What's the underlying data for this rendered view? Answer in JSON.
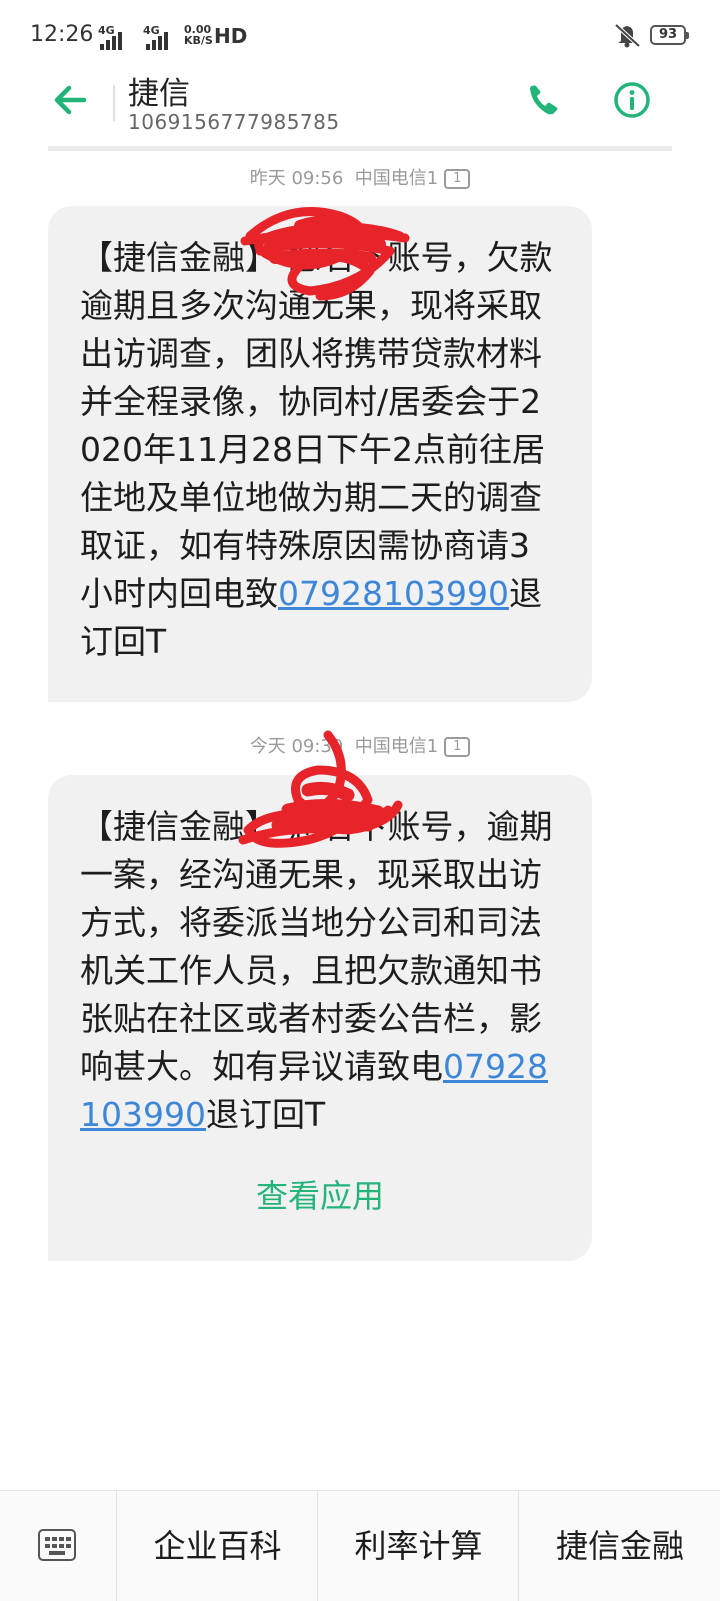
{
  "status_bar": {
    "time": "12:26",
    "signal1_label": "4G",
    "signal2_label": "4G",
    "net_speed_value": "0.00",
    "net_speed_unit": "KB/S",
    "hd_label": "HD",
    "battery": "93"
  },
  "header": {
    "title": "捷信",
    "sender_number": "1069156777985785",
    "accent_color": "#23b47a"
  },
  "messages": [
    {
      "timestamp": "昨天 09:56",
      "carrier": "中国电信1",
      "sim_slot": "1",
      "text_before": "【捷信金融】 您名下账号，欠款逾期且多次沟通无果，现将采取出访调查，团队将携带贷款材料并全程录像，协同村/居委会于2020年11月28日下午2点前往居住地及单位地做为期二天的调查取证，如有特殊原因需协商请3小时内回电致",
      "phone_link": "07928103990",
      "text_after": "退订回T"
    },
    {
      "timestamp": "今天 09:39",
      "carrier": "中国电信1",
      "sim_slot": "1",
      "text_before": "【捷信金融】 您名下账号，逾期一案，经沟通无果，现采取出访方式，将委派当地分公司和司法机关工作人员，且把欠款通知书张贴在社区或者村委公告栏，影响甚大。如有异议请致电",
      "phone_link": "07928103990",
      "text_after": "退订回T",
      "action_label": "查看应用"
    }
  ],
  "bottom_menu": {
    "keyboard_icon": "keyboard-icon",
    "items": [
      "企业百科",
      "利率计算",
      "捷信金融"
    ]
  }
}
